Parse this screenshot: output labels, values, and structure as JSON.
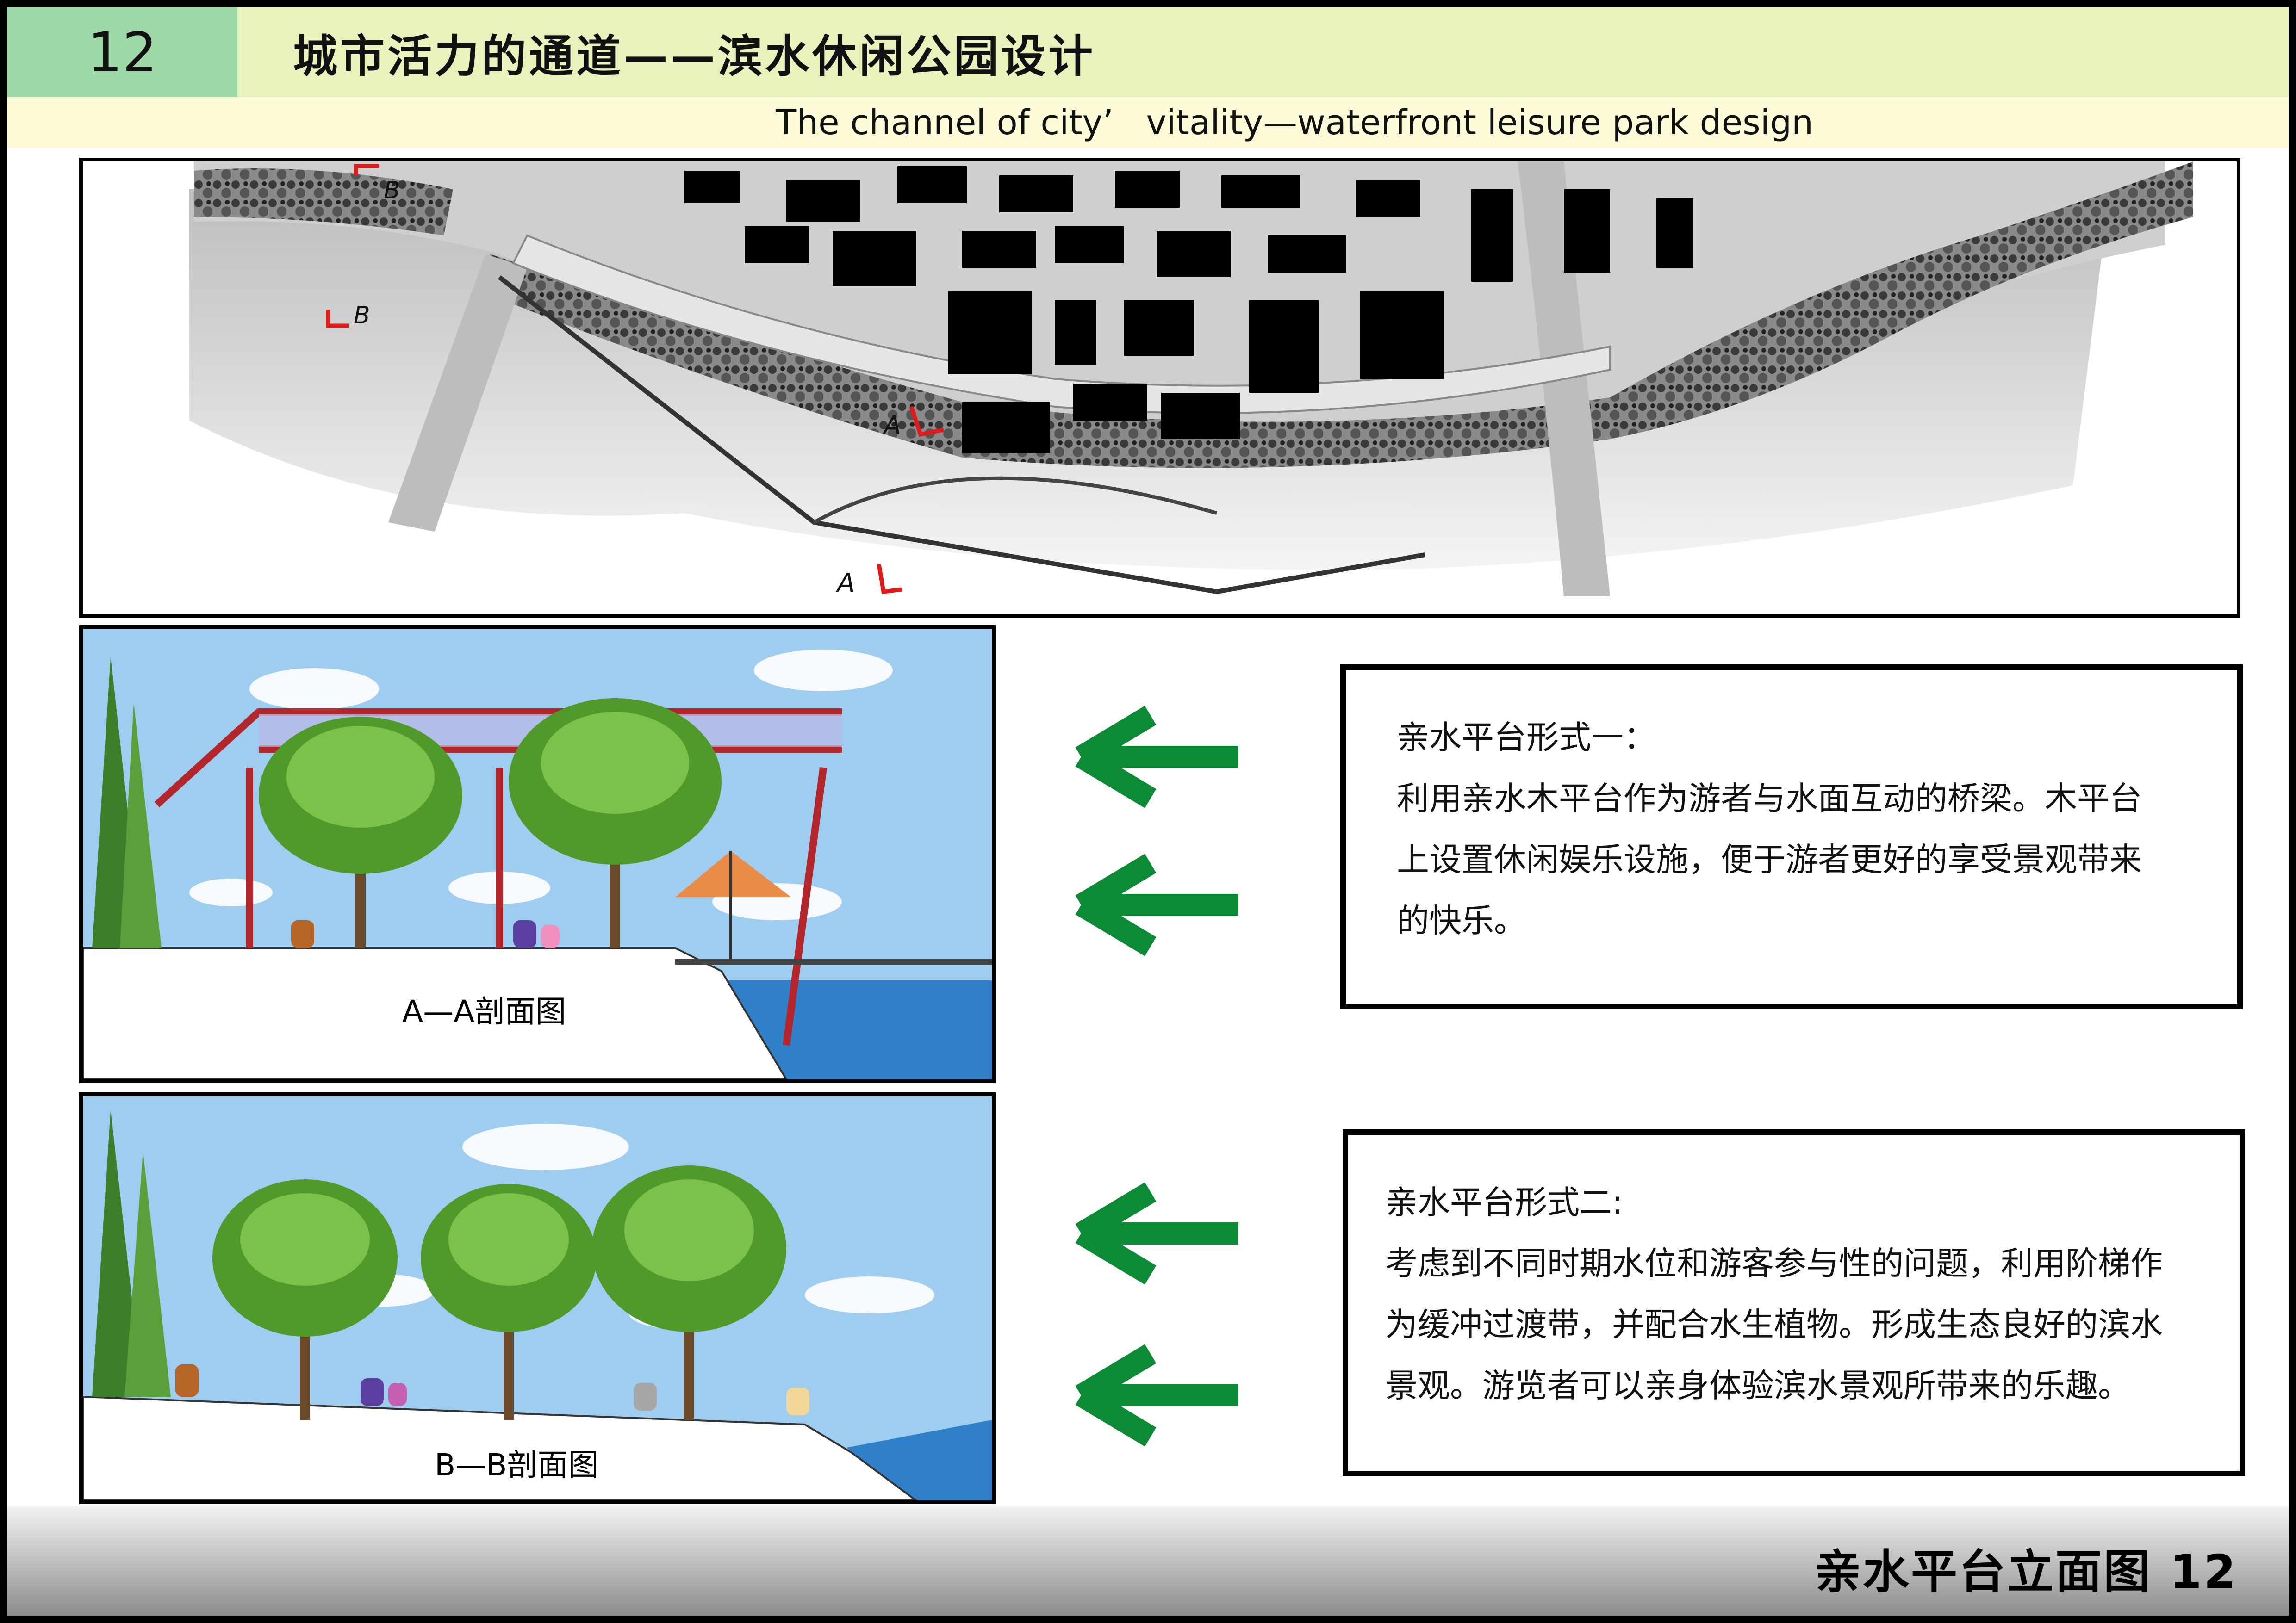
{
  "header": {
    "page_number": "12",
    "title": "城市活力的通道——滨水休闲公园设计",
    "subtitle": "The channel of city’   vitality—waterfront leisure park design"
  },
  "plan": {
    "marker_a_top": "A",
    "marker_a_bottom": "A",
    "marker_b_top": "B",
    "marker_b_left": "B"
  },
  "sections": {
    "a_label": "A—A剖面图",
    "b_label": "B—B剖面图"
  },
  "descriptions": [
    {
      "title": "亲水平台形式一：",
      "lines": [
        "利用亲水木平台作为游者与水面互动的桥梁。木平台",
        "上设置休闲娱乐设施，便于游者更好的享受景观带来",
        "的快乐。"
      ]
    },
    {
      "title": "亲水平台形式二:",
      "lines": [
        "考虑到不同时期水位和游客参与性的问题，利用阶梯作",
        "为缓冲过渡带，并配合水生植物。形成生态良好的滨水",
        "景观。游览者可以亲身体验滨水景观所带来的乐趣。"
      ]
    }
  ],
  "footer": {
    "label": "亲水平台立面图 12"
  },
  "colors": {
    "header_number_bg": "#9fd9a8",
    "header_title_bg": "#e8f2bd",
    "arrow": "#0c8a36",
    "section_marker": "#e11b1b"
  }
}
